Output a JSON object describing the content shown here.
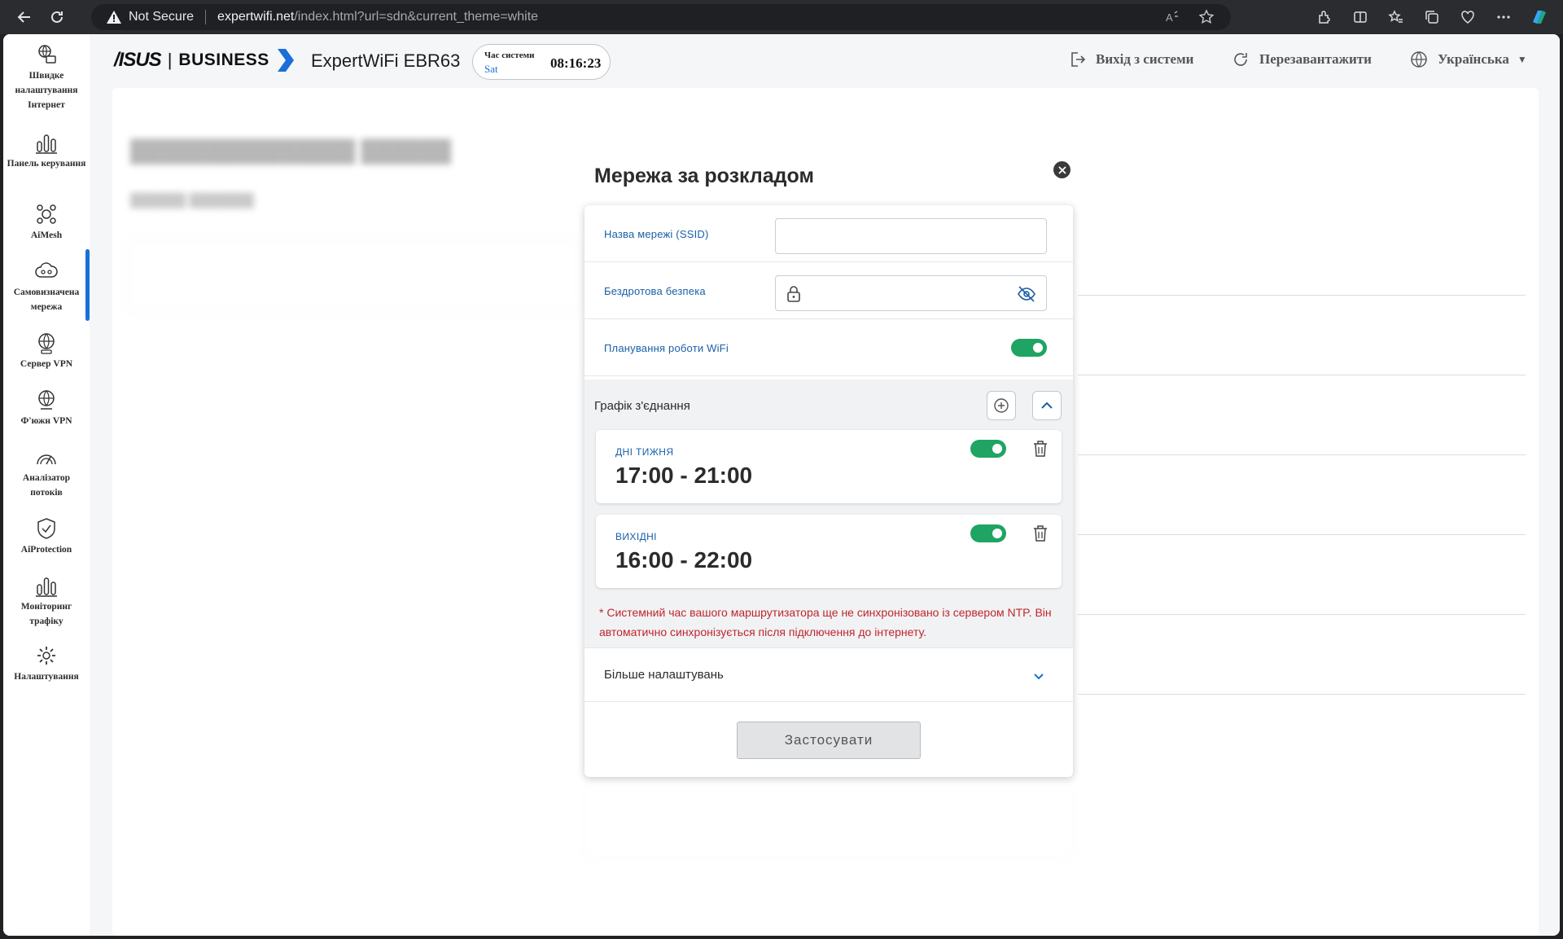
{
  "browser": {
    "security_label": "Not Secure",
    "url_host": "expertwifi.net",
    "url_rest": "/index.html?url=sdn&current_theme=white"
  },
  "sidebar": {
    "items": [
      {
        "label": "Швидке налаштування Інтернет",
        "icon": "quick-setup-icon"
      },
      {
        "label": "Панель керування",
        "icon": "dashboard-icon"
      },
      {
        "label": "AiMesh",
        "icon": "aimesh-icon"
      },
      {
        "label": "Самовизначена мережа",
        "icon": "custom-network-icon",
        "active": true
      },
      {
        "label": "Сервер VPN",
        "icon": "vpn-server-icon"
      },
      {
        "label": "Ф'южн VPN",
        "icon": "vpn-fusion-icon"
      },
      {
        "label": "Аналізатор потоків",
        "icon": "flow-analyzer-icon"
      },
      {
        "label": "AiProtection",
        "icon": "aiprotection-icon"
      },
      {
        "label": "Моніторинг трафіку",
        "icon": "traffic-monitor-icon"
      },
      {
        "label": "Налаштування",
        "icon": "settings-icon"
      }
    ]
  },
  "header": {
    "brand": "/ISUS",
    "brand_sep": "|",
    "brand_line": "BUSINESS",
    "model": "ExpertWiFi EBR63",
    "time_label": "Час системи",
    "time_day": "Sat",
    "time_value": "08:16:23",
    "logout_label": "Вихід з системи",
    "reboot_label": "Перезавантажити",
    "language_label": "Українська"
  },
  "modal": {
    "title": "Мережа за розкладом",
    "ssid_label": "Назва мережі (SSID)",
    "ssid_value": "",
    "security_label": "Бездротова безпека",
    "security_value": "",
    "schedule_toggle_label": "Планування роботи WiFi",
    "schedule_toggle_on": true,
    "schedule_title": "Графік з'єднання",
    "schedules": [
      {
        "type": "ДНІ ТИЖНЯ",
        "time": "17:00 - 21:00",
        "enabled": true
      },
      {
        "type": "ВИХІДНІ",
        "time": "16:00 - 22:00",
        "enabled": true
      }
    ],
    "ntp_warning": "* Системний час вашого маршрутизатора ще не синхронізовано із сервером NTP. Він автоматично синхронізується після підключення до інтернету.",
    "more_settings_label": "Більше налаштувань",
    "apply_label": "Застосувати"
  },
  "colors": {
    "accent": "#1a6fd8",
    "toggle_on": "#1fa463",
    "warning": "#c0262d"
  }
}
